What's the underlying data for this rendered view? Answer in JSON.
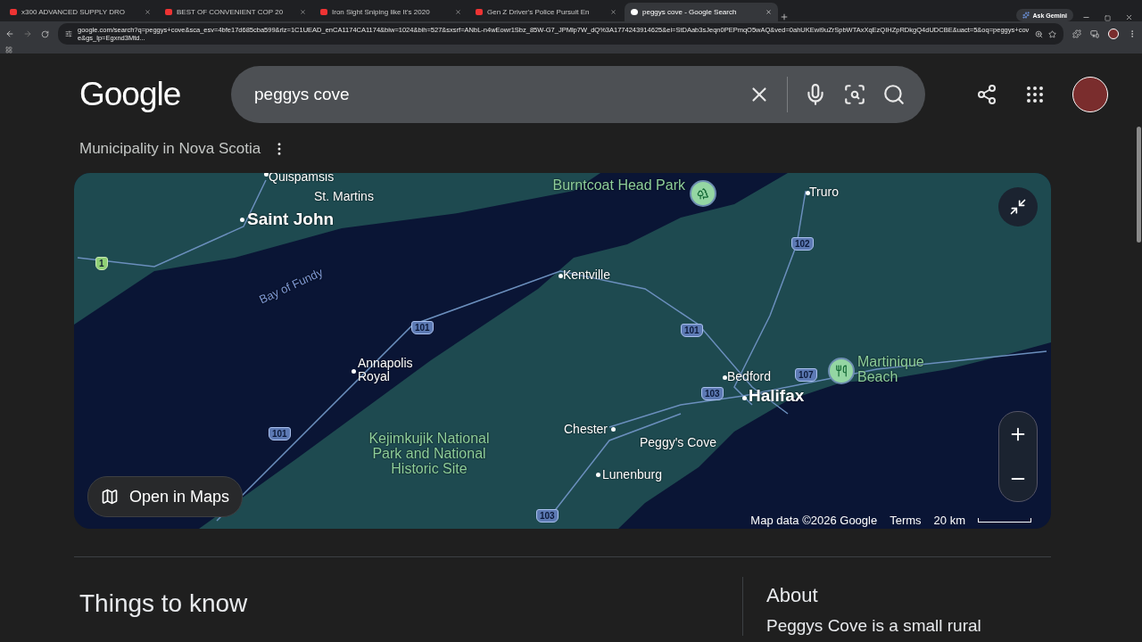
{
  "browser": {
    "tabs": [
      {
        "title": "x300 ADVANCED SUPPLY DRO",
        "kind": "video",
        "selected": false
      },
      {
        "title": "BEST OF CONVENIENT COP 20",
        "kind": "video",
        "selected": false
      },
      {
        "title": "Iron Sight Sniping like It's 2020",
        "kind": "video",
        "selected": false
      },
      {
        "title": "Gen Z Driver's Police Pursuit En",
        "kind": "video",
        "selected": false
      },
      {
        "title": "peggys cove - Google Search",
        "kind": "search",
        "selected": true
      }
    ],
    "ask_gemini": "Ask Gemini",
    "url": "google.com/search?q=peggys+cove&sca_esv=4bfe17d685cba599&rlz=1C1UEAD_enCA1174CA1174&biw=1024&bih=527&sxsrf=ANbL-n4wEowr1Sbz_85W-G7_JPMlp7W_dQ%3A1774243914625&ei=StDAab3sJeqn0PEPmqO5wAQ&ved=0ahUKEwi9uZrSpbWTAxXqEzQIHZpRDkgQ4dUDCBE&uact=5&oq=peggys+cove&gs_lp=Egxnd3Mtd..."
  },
  "header": {
    "logo": "Google",
    "query": "peggys cove"
  },
  "subtitle": "Municipality in Nova Scotia",
  "map": {
    "labels": [
      {
        "text": "Quispamsis",
        "kind": "town"
      },
      {
        "text": "St. Martins",
        "kind": "town"
      },
      {
        "text": "Saint John",
        "kind": "city"
      },
      {
        "text": "Bay of Fundy",
        "kind": "water"
      },
      {
        "text": "Burntcoat Head Park",
        "kind": "park"
      },
      {
        "text": "Truro",
        "kind": "town"
      },
      {
        "text": "Kentville",
        "kind": "town"
      },
      {
        "text": "Annapolis Royal",
        "kind": "town"
      },
      {
        "text": "Kejimkujik National Park and National Historic Site",
        "kind": "park"
      },
      {
        "text": "Chester",
        "kind": "town"
      },
      {
        "text": "Peggy's Cove",
        "kind": "town"
      },
      {
        "text": "Lunenburg",
        "kind": "town"
      },
      {
        "text": "Bedford",
        "kind": "town"
      },
      {
        "text": "Halifax",
        "kind": "city"
      },
      {
        "text": "Martinique Beach",
        "kind": "park"
      },
      {
        "text": "1",
        "kind": "shield"
      },
      {
        "text": "102",
        "kind": "shield"
      },
      {
        "text": "101",
        "kind": "shield"
      },
      {
        "text": "101",
        "kind": "shield"
      },
      {
        "text": "107",
        "kind": "shield"
      },
      {
        "text": "103",
        "kind": "shield"
      },
      {
        "text": "101",
        "kind": "shield"
      },
      {
        "text": "103",
        "kind": "shield"
      }
    ],
    "open_in_maps": "Open in Maps",
    "attribution": "Map data ©2026 Google",
    "terms": "Terms",
    "scale": "20 km"
  },
  "things_to_know": "Things to know",
  "about": {
    "title": "About",
    "text": "Peggys Cove is a small rural"
  }
}
